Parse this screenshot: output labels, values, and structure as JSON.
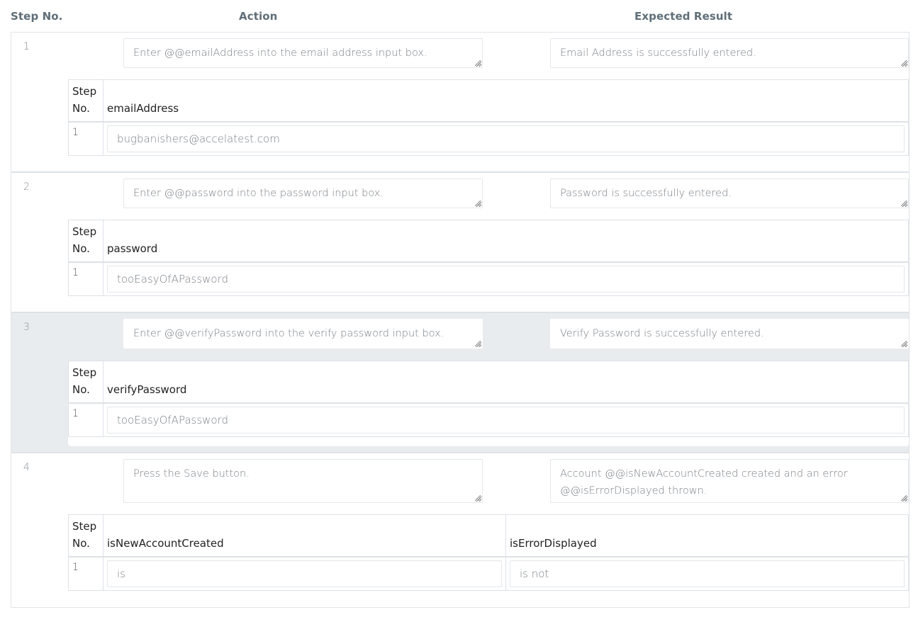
{
  "header": {
    "step_no": "Step No.",
    "action": "Action",
    "expected_result": "Expected Result"
  },
  "steps": [
    {
      "number": "1",
      "action": "Enter @@emailAddress into the email address input box.",
      "expected": "Email Address is successfully entered.",
      "highlighted": false,
      "params": {
        "step_header": [
          "Step",
          "No."
        ],
        "columns": [
          "emailAddress"
        ],
        "rows": [
          {
            "step": "1",
            "values": [
              "bugbanishers@accelatest.com"
            ]
          }
        ]
      }
    },
    {
      "number": "2",
      "action": "Enter @@password into the password input box.",
      "expected": "Password is successfully entered.",
      "highlighted": false,
      "params": {
        "step_header": [
          "Step",
          "No."
        ],
        "columns": [
          "password"
        ],
        "rows": [
          {
            "step": "1",
            "values": [
              "tooEasyOfAPassword"
            ]
          }
        ]
      }
    },
    {
      "number": "3",
      "action": "Enter @@verifyPassword into the verify password input box.",
      "expected": "Verify Password is successfully entered.",
      "highlighted": true,
      "params": {
        "step_header": [
          "Step",
          "No."
        ],
        "columns": [
          "verifyPassword"
        ],
        "rows": [
          {
            "step": "1",
            "values": [
              "tooEasyOfAPassword"
            ]
          }
        ]
      }
    },
    {
      "number": "4",
      "action": "Press the Save button.",
      "expected": "Account @@isNewAccountCreated created and an error @@isErrorDisplayed thrown.",
      "highlighted": false,
      "params": {
        "step_header": [
          "Step",
          "No."
        ],
        "columns": [
          "isNewAccountCreated",
          "isErrorDisplayed"
        ],
        "rows": [
          {
            "step": "1",
            "values": [
              "is",
              "is not"
            ]
          }
        ]
      }
    }
  ],
  "colors": {
    "highlight_bg": "#e8ecef",
    "header_text": "#5f6e78",
    "border": "#dee2e6"
  }
}
